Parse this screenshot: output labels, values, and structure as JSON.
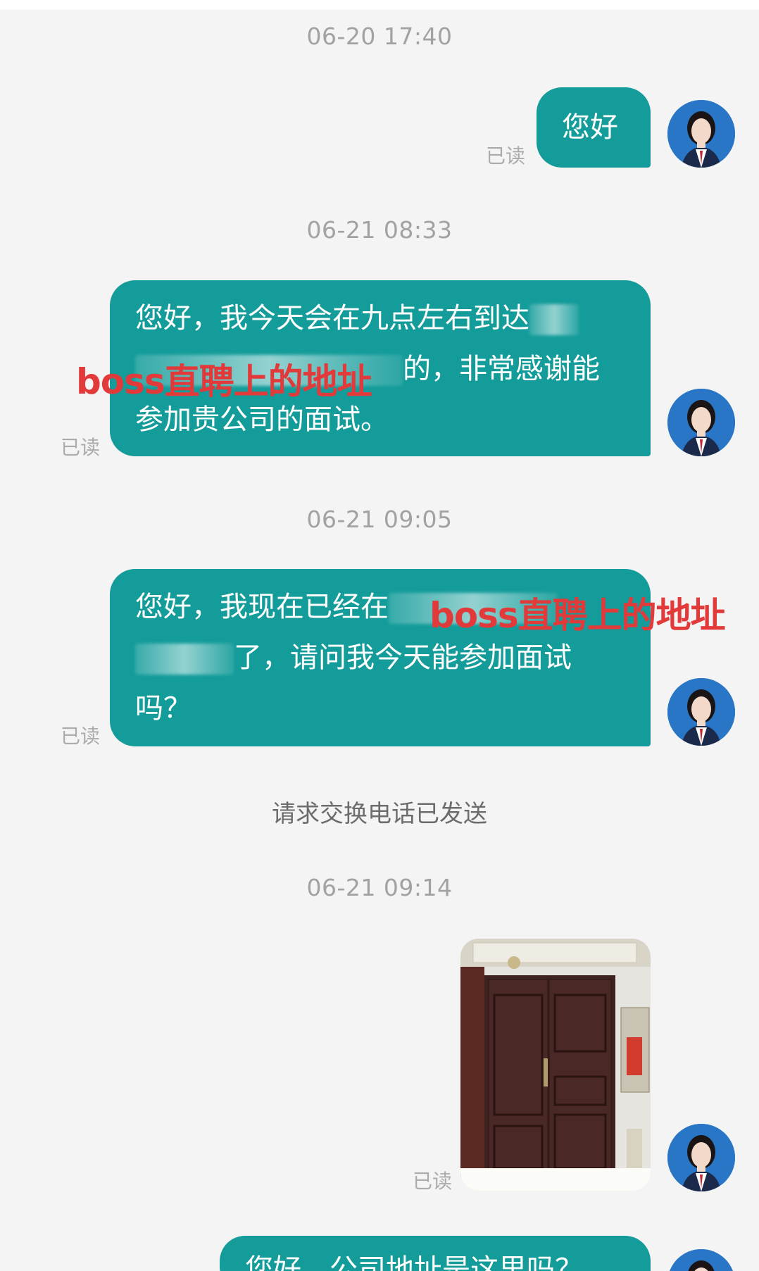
{
  "timestamps": [
    "06-20 17:40",
    "06-21 08:33",
    "06-21 09:05",
    "06-21 09:14"
  ],
  "messages": {
    "m1": {
      "text": "您好",
      "status": "已读"
    },
    "m2": {
      "line1": "您好，我今天会在九点左右到达",
      "line2": "的，非常感谢能",
      "line3": "参加贵公司的面试。",
      "status": "已读",
      "watermark": "boss直聘上的地址"
    },
    "m3": {
      "line1": "您好，我现在已经在",
      "line2": "了，请问我今天能参加面试",
      "line3": "吗？",
      "status": "已读",
      "watermark": "boss直聘上的地址"
    },
    "system_notice": "请求交换电话已发送",
    "m4": {
      "status": "已读"
    },
    "m5": {
      "text": "您好，公司地址是这里吗？"
    }
  },
  "colors": {
    "bubble": "#149c9a",
    "background": "#f4f4f4",
    "watermark": "#e23a3a",
    "avatar_bg": "#2a76c6"
  },
  "icons": {
    "avatar": "user-avatar-icon",
    "photo": "door-photo"
  }
}
